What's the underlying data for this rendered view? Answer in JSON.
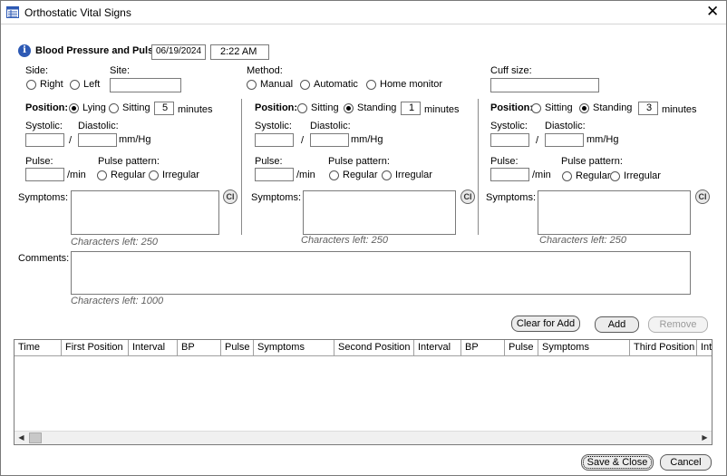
{
  "window": {
    "title": "Orthostatic Vital Signs",
    "close_glyph": "✕"
  },
  "header": {
    "label": "Blood Pressure and Pulse:",
    "date": "06/19/2024",
    "time": "2:22 AM",
    "info_glyph": "i"
  },
  "general": {
    "side_label": "Side:",
    "side_right": "Right",
    "side_left": "Left",
    "site_label": "Site:",
    "site_value": "",
    "method_label": "Method:",
    "method_manual": "Manual",
    "method_automatic": "Automatic",
    "method_home": "Home monitor",
    "cuff_label": "Cuff size:",
    "cuff_value": ""
  },
  "common": {
    "position_label": "Position:",
    "minutes": "minutes",
    "systolic": "Systolic:",
    "diastolic": "Diastolic:",
    "slash": "/",
    "mmhg": "mm/Hg",
    "pulse": "Pulse:",
    "per_min": "/min",
    "pulse_pattern": "Pulse pattern:",
    "regular": "Regular",
    "irregular": "Irregular",
    "symptoms": "Symptoms:",
    "chars_left_symptoms": "Characters left: 250",
    "ci": "CI"
  },
  "panels": [
    {
      "opt1": "Lying",
      "opt2": "Sitting",
      "selected": 1,
      "minutes_value": "5"
    },
    {
      "opt1": "Sitting",
      "opt2": "Standing",
      "selected": 2,
      "minutes_value": "1"
    },
    {
      "opt1": "Sitting",
      "opt2": "Standing",
      "selected": 2,
      "minutes_value": "3"
    }
  ],
  "comments": {
    "label": "Comments:",
    "chars_left": "Characters left: 1000"
  },
  "buttons": {
    "clear_for_add": "Clear for Add",
    "add": "Add",
    "remove": "Remove",
    "save_close": "Save & Close",
    "cancel": "Cancel"
  },
  "table": {
    "columns": [
      "Time",
      "First Position",
      "Interval",
      "BP",
      "Pulse",
      "Symptoms",
      "Second Position",
      "Interval",
      "BP",
      "Pulse",
      "Symptoms",
      "Third Position",
      "Interval"
    ],
    "rows": []
  }
}
